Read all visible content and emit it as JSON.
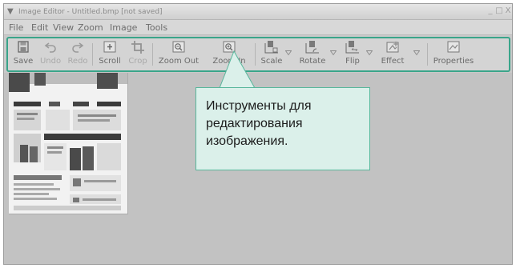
{
  "window": {
    "title": "Image Editor - Untitled.bmp [not saved]",
    "controls": [
      "_",
      "□",
      "X"
    ]
  },
  "menu": {
    "items": [
      "File",
      "Edit",
      "View",
      "Zoom",
      "Image",
      "Tools"
    ]
  },
  "toolbar": {
    "items": [
      {
        "label": "Save",
        "icon": "save-icon",
        "enabled": true,
        "dropdown": false
      },
      {
        "label": "Undo",
        "icon": "undo-icon",
        "enabled": false,
        "dropdown": false
      },
      {
        "label": "Redo",
        "icon": "redo-icon",
        "enabled": false,
        "dropdown": false
      },
      {
        "label": "Scroll",
        "icon": "scroll-icon",
        "enabled": true,
        "dropdown": false
      },
      {
        "label": "Crop",
        "icon": "crop-icon",
        "enabled": false,
        "dropdown": false
      },
      {
        "label": "Zoom Out",
        "icon": "zoom-out-icon",
        "enabled": true,
        "dropdown": false
      },
      {
        "label": "Zoom In",
        "icon": "zoom-in-icon",
        "enabled": true,
        "dropdown": false
      },
      {
        "label": "Scale",
        "icon": "scale-icon",
        "enabled": true,
        "dropdown": true
      },
      {
        "label": "Rotate",
        "icon": "rotate-icon",
        "enabled": true,
        "dropdown": true
      },
      {
        "label": "Flip",
        "icon": "flip-icon",
        "enabled": true,
        "dropdown": true
      },
      {
        "label": "Effect",
        "icon": "effect-icon",
        "enabled": true,
        "dropdown": true
      },
      {
        "label": "Properties",
        "icon": "properties-icon",
        "enabled": true,
        "dropdown": false
      }
    ]
  },
  "callout": {
    "lines": [
      "Инструменты для",
      "редактирования",
      "изображения."
    ]
  },
  "colors": {
    "highlight_border": "#3aa58a",
    "callout_fill": "#dbf0ea",
    "canvas": "#c2c2c2"
  }
}
